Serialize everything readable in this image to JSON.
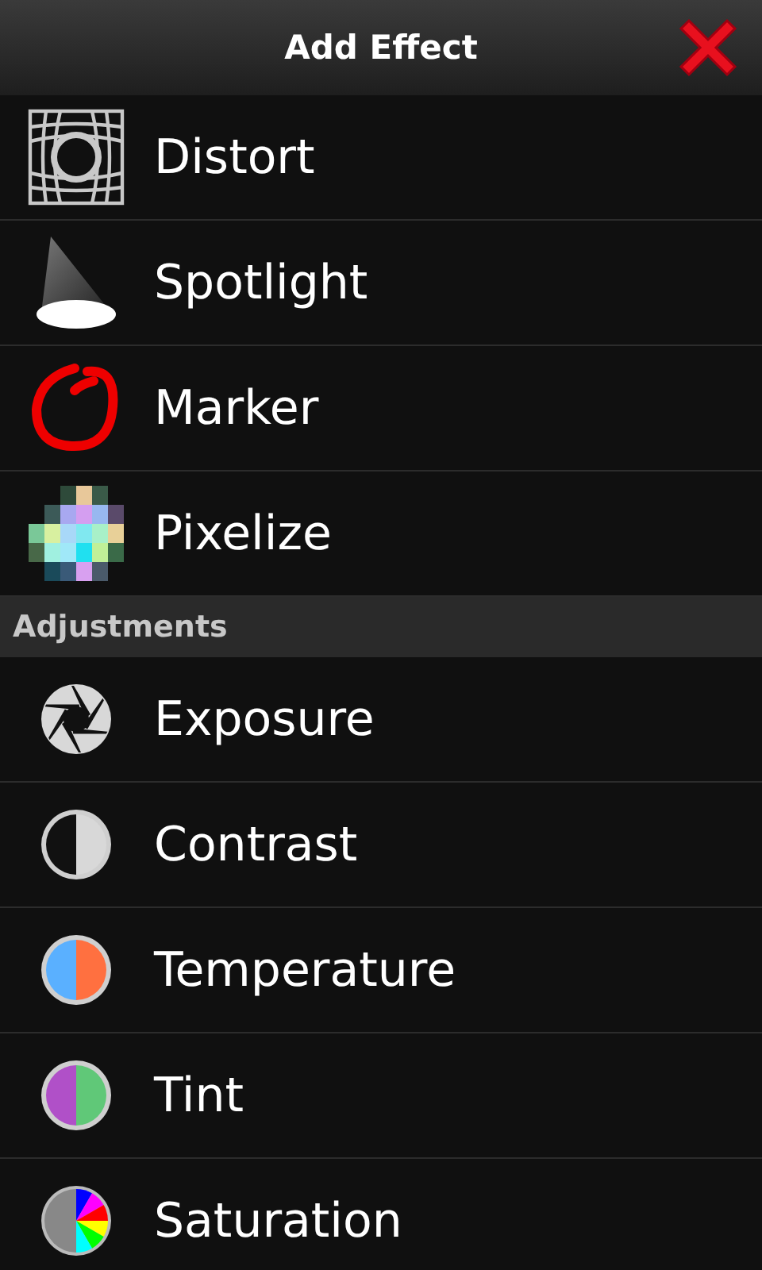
{
  "header": {
    "title": "Add Effect"
  },
  "groups": [
    {
      "items": [
        {
          "label": "Distort"
        },
        {
          "label": "Spotlight"
        },
        {
          "label": "Marker"
        },
        {
          "label": "Pixelize"
        }
      ]
    },
    {
      "title": "Adjustments",
      "items": [
        {
          "label": "Exposure"
        },
        {
          "label": "Contrast"
        },
        {
          "label": "Temperature"
        },
        {
          "label": "Tint"
        },
        {
          "label": "Saturation"
        }
      ]
    }
  ]
}
